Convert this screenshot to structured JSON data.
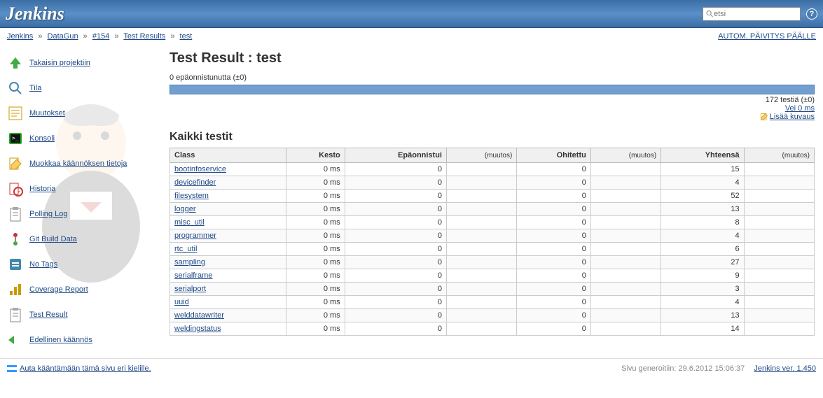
{
  "header": {
    "logo": "Jenkins",
    "search_placeholder": "etsi"
  },
  "breadcrumb": {
    "items": [
      "Jenkins",
      "DataGun",
      "#154",
      "Test Results",
      "test"
    ],
    "auto_refresh": "AUTOM. PÄIVITYS PÄÄLLE"
  },
  "sidebar": {
    "items": [
      {
        "icon": "up-arrow",
        "label": "Takaisin projektiin"
      },
      {
        "icon": "search",
        "label": "Tila"
      },
      {
        "icon": "muutokset",
        "label": "Muutokset"
      },
      {
        "icon": "terminal",
        "label": "Konsoli"
      },
      {
        "icon": "edit",
        "label": "Muokkaa käännöksen tietoja"
      },
      {
        "icon": "history",
        "label": "Historia"
      },
      {
        "icon": "clipboard",
        "label": "Polling Log"
      },
      {
        "icon": "git",
        "label": "Git Build Data"
      },
      {
        "icon": "notags",
        "label": "No Tags"
      },
      {
        "icon": "coverage",
        "label": "Coverage Report"
      },
      {
        "icon": "clipboard",
        "label": "Test Result"
      },
      {
        "icon": "prev",
        "label": "Edellinen käännös"
      }
    ]
  },
  "content": {
    "title": "Test Result : test",
    "fail_summary": "0 epäonnistunutta (±0)",
    "test_count": "172 testiä (±0)",
    "took": "Vei 0 ms",
    "add_description": "Lisää kuvaus",
    "section_title": "Kaikki testit",
    "columns": {
      "class": "Class",
      "kesto": "Kesto",
      "fail": "Epäonnistui",
      "diff": "(muutos)",
      "skip": "Ohitettu",
      "total": "Yhteensä"
    },
    "rows": [
      {
        "name": "bootinfoservice",
        "kesto": "0 ms",
        "fail": "0",
        "fail_d": "",
        "skip": "0",
        "skip_d": "",
        "total": "15",
        "total_d": ""
      },
      {
        "name": "devicefinder",
        "kesto": "0 ms",
        "fail": "0",
        "fail_d": "",
        "skip": "0",
        "skip_d": "",
        "total": "4",
        "total_d": ""
      },
      {
        "name": "filesystem",
        "kesto": "0 ms",
        "fail": "0",
        "fail_d": "",
        "skip": "0",
        "skip_d": "",
        "total": "52",
        "total_d": ""
      },
      {
        "name": "logger",
        "kesto": "0 ms",
        "fail": "0",
        "fail_d": "",
        "skip": "0",
        "skip_d": "",
        "total": "13",
        "total_d": ""
      },
      {
        "name": "misc_util",
        "kesto": "0 ms",
        "fail": "0",
        "fail_d": "",
        "skip": "0",
        "skip_d": "",
        "total": "8",
        "total_d": ""
      },
      {
        "name": "programmer",
        "kesto": "0 ms",
        "fail": "0",
        "fail_d": "",
        "skip": "0",
        "skip_d": "",
        "total": "4",
        "total_d": ""
      },
      {
        "name": "rtc_util",
        "kesto": "0 ms",
        "fail": "0",
        "fail_d": "",
        "skip": "0",
        "skip_d": "",
        "total": "6",
        "total_d": ""
      },
      {
        "name": "sampling",
        "kesto": "0 ms",
        "fail": "0",
        "fail_d": "",
        "skip": "0",
        "skip_d": "",
        "total": "27",
        "total_d": ""
      },
      {
        "name": "serialframe",
        "kesto": "0 ms",
        "fail": "0",
        "fail_d": "",
        "skip": "0",
        "skip_d": "",
        "total": "9",
        "total_d": ""
      },
      {
        "name": "serialport",
        "kesto": "0 ms",
        "fail": "0",
        "fail_d": "",
        "skip": "0",
        "skip_d": "",
        "total": "3",
        "total_d": ""
      },
      {
        "name": "uuid",
        "kesto": "0 ms",
        "fail": "0",
        "fail_d": "",
        "skip": "0",
        "skip_d": "",
        "total": "4",
        "total_d": ""
      },
      {
        "name": "welddatawriter",
        "kesto": "0 ms",
        "fail": "0",
        "fail_d": "",
        "skip": "0",
        "skip_d": "",
        "total": "13",
        "total_d": ""
      },
      {
        "name": "weldingstatus",
        "kesto": "0 ms",
        "fail": "0",
        "fail_d": "",
        "skip": "0",
        "skip_d": "",
        "total": "14",
        "total_d": ""
      }
    ]
  },
  "footer": {
    "translate": "Auta kääntämään tämä sivu eri kielille.",
    "generated": "Sivu generoitiin: 29.6.2012 15:06:37",
    "version": "Jenkins ver. 1.450"
  }
}
